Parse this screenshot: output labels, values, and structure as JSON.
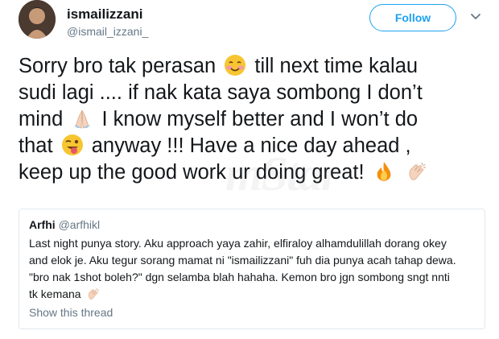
{
  "header": {
    "display_name": "ismailizzani",
    "handle": "@ismail_izzani_",
    "follow_label": "Follow"
  },
  "tweet": {
    "lines": [
      {
        "before": "Sorry bro tak perasan",
        "emoji": "smiling-blushing-face-emoji",
        "after": "till next time kalau"
      },
      {
        "before": "sudi lagi .... if nak kata saya sombong I don’t",
        "emoji": "",
        "after": ""
      },
      {
        "before": "mind",
        "emoji": "folded-hands-emoji",
        "after": "I know myself better and I won’t do"
      },
      {
        "before": "that",
        "emoji": "winking-tongue-face-emoji",
        "after": "anyway !!! Have a nice day ahead ,"
      },
      {
        "before": "keep up the good work ur doing great!",
        "emoji": "fire-emoji",
        "after": ""
      }
    ]
  },
  "watermark": "mStar",
  "quote": {
    "name": "Arfhi",
    "handle": "@arfhikl",
    "lines": [
      "Last night punya story. Aku approach yaya zahir, elfiraloy alhamdulillah dorang okey",
      "and elok je. Aku tegur sorang mamat ni \"ismailizzani\" fuh dia punya acah tahap dewa.",
      "\"bro nak 1shot boleh?\" dgn selamba blah hahaha. Kemon bro jgn sombong sngt nnti",
      "tk kemana"
    ],
    "thread_link": "Show this thread"
  },
  "colors": {
    "accent": "#1da1f2",
    "secondary_text": "#657786",
    "border": "#e1e8ed"
  }
}
